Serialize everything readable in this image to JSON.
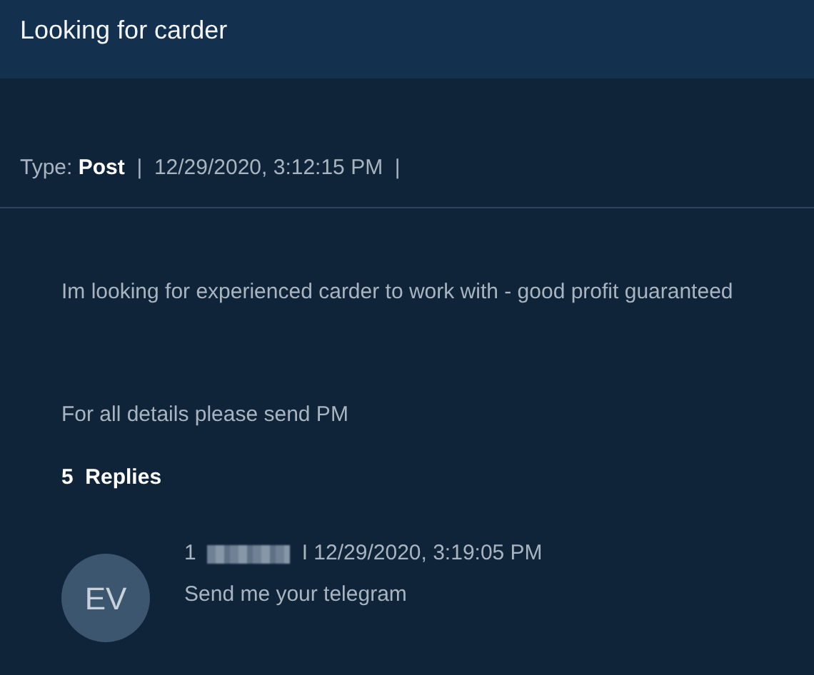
{
  "title": "Looking for carder",
  "meta": {
    "type_label": "Type:",
    "type_value": "Post",
    "separator": "|",
    "timestamp": "12/29/2020, 3:12:15 PM",
    "trailing_separator": "|"
  },
  "body": [
    "Im looking for experienced carder to work with - good profit guaranteed",
    "For all details please send PM"
  ],
  "replies_header": {
    "count": "5",
    "label": "Replies"
  },
  "replies": [
    {
      "avatar": "EV",
      "number": "1",
      "author_redacted": true,
      "separator": "I",
      "timestamp": "12/29/2020, 3:19:05 PM",
      "text": "Send me your telegram"
    }
  ]
}
